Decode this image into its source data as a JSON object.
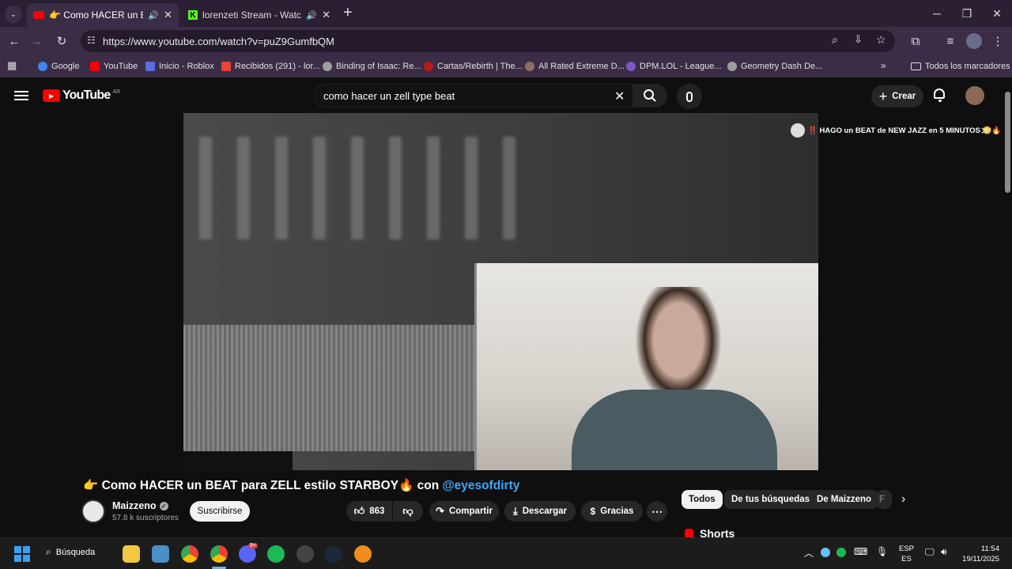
{
  "tabs": [
    {
      "title": "👉 Como HACER un BEAT p",
      "active": true
    },
    {
      "title": "lorenzeti Stream - Watch Li",
      "active": false
    }
  ],
  "new_tab_label": "+",
  "address_bar": {
    "url": "https://www.youtube.com/watch?v=puZ9GumfbQM"
  },
  "bookmarks": {
    "items": [
      {
        "label": "Google",
        "color": "#4285f4"
      },
      {
        "label": "YouTube",
        "color": "#ff0000"
      },
      {
        "label": "Inicio - Roblox",
        "color": "#5b6ee1"
      },
      {
        "label": "Recibidos (291) - lor...",
        "color": "#ea4335"
      },
      {
        "label": "Binding of Isaac: Re...",
        "color": "#9e9e9e"
      },
      {
        "label": "Cartas/Rebirth | The...",
        "color": "#b71c1c"
      },
      {
        "label": "All Rated Extreme D...",
        "color": "#8d6e63"
      },
      {
        "label": "DPM.LOL - League...",
        "color": "#7e57c2"
      },
      {
        "label": "Geometry Dash De...",
        "color": "#9e9e9e"
      }
    ],
    "all_bookmarks": "Todos los marcadores"
  },
  "youtube": {
    "logo_text": "YouTube",
    "logo_region": "AR",
    "search_value": "como hacer un zell type beat",
    "create_label": "Crear",
    "miniplayer_title": "‼️ HAGO un BEAT de NEW JAZZ en 5 MINUTOS 😳🔥",
    "video_title": "👉 Como HACER un BEAT para ZELL estilo STARBOY🔥 con",
    "video_title_mention": "@eyesofdirty",
    "channel_name": "Maizzeno",
    "subscribers": "57.8 k suscriptores",
    "subscribe_label": "Suscribirse",
    "likes": "863",
    "share_label": "Compartir",
    "download_label": "Descargar",
    "thanks_label": "Gracias",
    "chips": [
      "Todos",
      "De tus búsquedas",
      "De Maizzeno",
      "F"
    ],
    "shorts_label": "Shorts",
    "accent_color": "#ff0000",
    "link_color": "#3ea6ff"
  },
  "taskbar": {
    "search_label": "Búsqueda",
    "lang_top": "ESP",
    "lang_bottom": "ES",
    "time": "11:54",
    "date": "19/11/2025",
    "discord_badge": "9+"
  }
}
